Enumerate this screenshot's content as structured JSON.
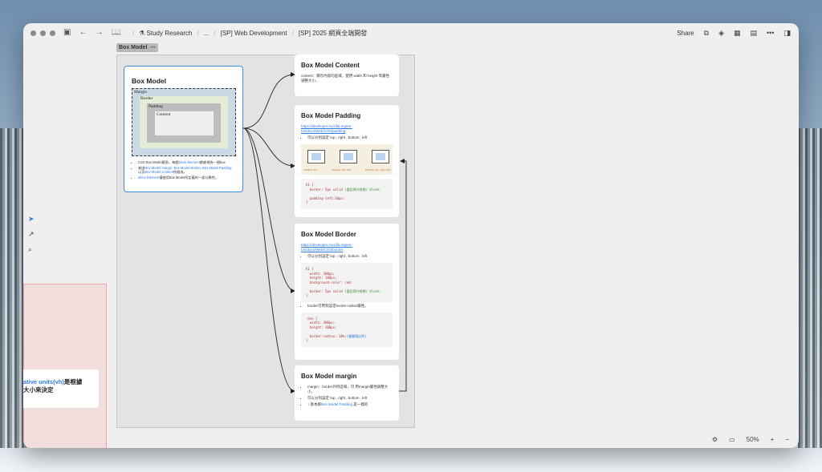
{
  "titlebar": {
    "breadcrumbs": [
      "Study Research",
      "...",
      "[SP] Web Development",
      "[SP] 2025 網頁全端開發"
    ],
    "share_label": "Share"
  },
  "canvas": {
    "group_label": "Box Model",
    "group_more": "•••",
    "vh_card": {
      "link_text": "ative units(vh)",
      "text_1": "是根據",
      "text_2": "大小來決定"
    },
    "box_model_card": {
      "title": "Box Model",
      "diagram_labels": {
        "margin": "Margin",
        "border": "Border",
        "padding": "Padding",
        "content": "Content"
      },
      "bullets": [
        {
          "pre": "CSS Box Model意即，每個",
          "link": "block Element",
          "post": "都被視為一個box"
        },
        {
          "pre": "者由",
          "link": "Box Model margin, Box Model Border, Box Model Padding",
          "mid": " 以及",
          "link2": "Box Model Content",
          "post": "所組成。"
        },
        {
          "pre": "",
          "link": "inline Element",
          "post": "僅使用box Model所定義的一部分屬性。"
        }
      ]
    },
    "content_card": {
      "title": "Box Model Content",
      "text": "content：顯示內容的區域，使用 width 和 height 等屬性調整大小。"
    },
    "padding_card": {
      "title": "Box Model Padding",
      "link": "https://developer.mozilla.org/en-US/docs/Web/CSS/padding",
      "bullets": [
        "可以分別設定 top , right , bottom , left"
      ],
      "captions": [
        "Padding: 5px",
        "Padding: 5px 10px",
        "Padding: 5px 10px 20px"
      ],
      "code_lines": [
        "h1 {",
        "  border: 5px solid",
        "  padding-left:10px;",
        "}"
      ],
      "code_comment": "(要記得外框線) black;"
    },
    "border_card": {
      "title": "Box Model Border",
      "link": "https://developer.mozilla.org/en-US/docs/Web/CSS/border",
      "bullets": [
        "可以分別設定 top , right , bottom , left",
        "border可用到設定border-radius屬性。"
      ],
      "code1": [
        "h1 {",
        "  width: 300px;",
        "  height: 100px;",
        "  background-color: red;",
        "  border: 5px solid",
        "}"
      ],
      "code1_comment": "(要記得外框線) black;",
      "code2": [
        ".box {",
        "  width: 300px;",
        "  height: 300px;",
        "  border-radius: 10%;",
        "}"
      ],
      "code2_comment": "(會圓角比例)"
    },
    "margin_card": {
      "title": "Box Model margin",
      "bullets": [
        {
          "pre": "margin：border外的區域，可 用margin屬性調整大小。",
          "link": "",
          "post": ""
        },
        {
          "pre": "可以分別設定 top , right , bottom , left",
          "link": "",
          "post": ""
        },
        {
          "pre": "↑ 基本跟",
          "link": "Box Model Padding",
          "post": " 是一樣的"
        }
      ]
    }
  },
  "bottombar": {
    "zoom": "50%",
    "plus": "+",
    "minus": "−"
  }
}
